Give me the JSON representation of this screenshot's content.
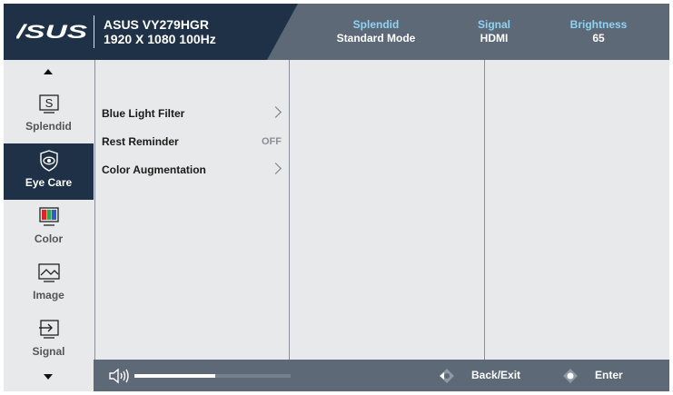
{
  "header": {
    "brand": "/SUS",
    "model": "ASUS VY279HGR",
    "resolution": "1920 X 1080 100Hz",
    "status": [
      {
        "label": "Splendid",
        "value": "Standard Mode"
      },
      {
        "label": "Signal",
        "value": "HDMI"
      },
      {
        "label": "Brightness",
        "value": "65"
      }
    ]
  },
  "sidebar": {
    "items": [
      {
        "label": "Splendid",
        "icon": "splendid-icon"
      },
      {
        "label": "Eye Care",
        "icon": "eye-care-icon",
        "active": true
      },
      {
        "label": "Color",
        "icon": "color-icon"
      },
      {
        "label": "Image",
        "icon": "image-icon"
      },
      {
        "label": "Signal",
        "icon": "signal-icon"
      }
    ]
  },
  "menu": {
    "items": [
      {
        "label": "Blue Light Filter",
        "has_submenu": true
      },
      {
        "label": "Rest Reminder",
        "value": "OFF"
      },
      {
        "label": "Color Augmentation",
        "has_submenu": true
      }
    ]
  },
  "footer": {
    "volume_level": 0.52,
    "back_label": "Back/Exit",
    "enter_label": "Enter"
  },
  "colors": {
    "header_bg": "#1e3146",
    "header_status_bg": "#5d6977",
    "status_label": "#8fd3f2",
    "active_item_bg": "#1e3146",
    "panel_bg": "#e8e9ea"
  }
}
